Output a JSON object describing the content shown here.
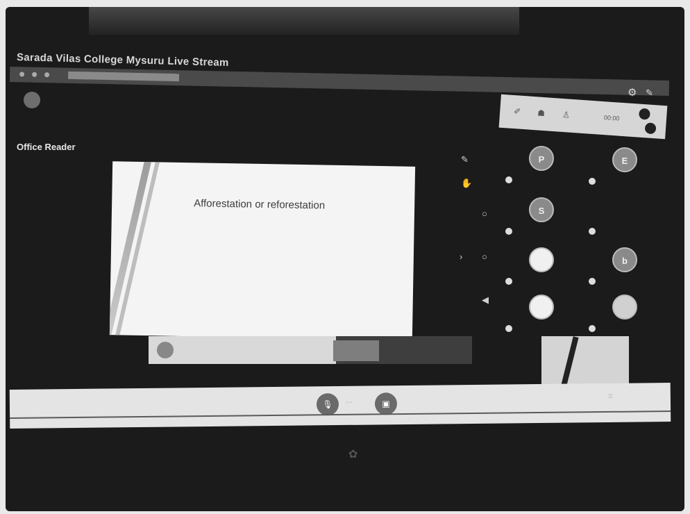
{
  "window": {
    "title": "Sarada Vilas College Mysuru Live Stream"
  },
  "browser": {
    "url": ""
  },
  "header": {
    "org_name": ""
  },
  "section": {
    "title": "Office Reader"
  },
  "slide": {
    "title": "Afforestation or reforestation",
    "left_bullet": "",
    "right_bullet": ""
  },
  "slide_bar": {
    "text": "",
    "button": ""
  },
  "presenter_note": "",
  "participants": [
    {
      "initial": "P",
      "name": ""
    },
    {
      "initial": "E",
      "name": ""
    },
    {
      "initial": "S",
      "name": ""
    },
    {
      "initial": "",
      "name": ""
    },
    {
      "initial": "",
      "name": ""
    },
    {
      "initial": "b",
      "name": ""
    },
    {
      "initial": "",
      "name": ""
    },
    {
      "initial": "",
      "name": ""
    }
  ],
  "bottom": {
    "label": ""
  },
  "icons": {
    "settings": "gear-icon",
    "pin": "pin-icon",
    "mic": "microphone-icon",
    "camera": "camera-icon"
  }
}
